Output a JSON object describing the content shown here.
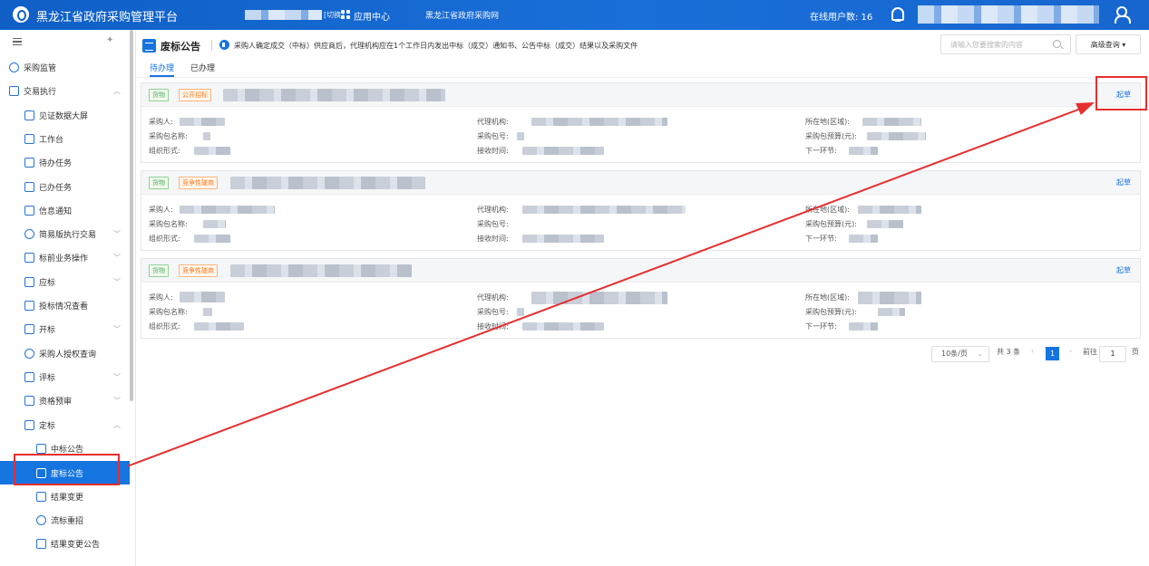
{
  "topbar": {
    "app_title": "黑龙江省政府采购管理平台",
    "switch_label": "[切换]",
    "app_center": "应用中心",
    "site_link": "黑龙江省政府采购网",
    "online_users": "在线用户数: 16"
  },
  "sidebar": {
    "items": [
      {
        "label": "采购监管"
      },
      {
        "label": "交易执行"
      },
      {
        "label": "见证数据大屏"
      },
      {
        "label": "工作台"
      },
      {
        "label": "待办任务"
      },
      {
        "label": "已办任务"
      },
      {
        "label": "信息通知"
      },
      {
        "label": "简易版执行交易"
      },
      {
        "label": "标前业务操作"
      },
      {
        "label": "应标"
      },
      {
        "label": "投标情况查看"
      },
      {
        "label": "开标"
      },
      {
        "label": "采购人授权查询"
      },
      {
        "label": "评标"
      },
      {
        "label": "资格预审"
      },
      {
        "label": "定标"
      },
      {
        "label": "中标公告"
      },
      {
        "label": "废标公告"
      },
      {
        "label": "结果变更"
      },
      {
        "label": "流标重招"
      },
      {
        "label": "结果变更公告"
      }
    ]
  },
  "header": {
    "title": "废标公告",
    "notice": "采购人确定成交（中标）供应商后，代理机构应在1个工作日内发出中标（成交）通知书、公告中标（成交）结果以及采购文件",
    "search_placeholder": "请输入您要搜索的内容",
    "advanced_search": "高级查询"
  },
  "tabs": [
    {
      "label": "待办理"
    },
    {
      "label": "已办理"
    }
  ],
  "field_labels": {
    "purchaser": "采购人:",
    "agency": "代理机构:",
    "region": "所在地(区域):",
    "package_name": "采购包名称:",
    "package_no": "采购包号:",
    "budget": "采购包预算(元):",
    "org_form": "组织形式:",
    "receive_time": "接收时间:",
    "next_step": "下一环节:"
  },
  "cards": [
    {
      "goods_tag": "货物",
      "method_tag": "公开招标",
      "action": "起草"
    },
    {
      "goods_tag": "货物",
      "method_tag": "竞争性磋商",
      "action": "起草"
    },
    {
      "goods_tag": "货物",
      "method_tag": "竞争性磋商",
      "action": "起草"
    }
  ],
  "pagination": {
    "page_size": "10条/页",
    "total": "共 3 条",
    "current_page": "1",
    "goto_label": "前往",
    "goto_value": "1",
    "page_unit": "页"
  },
  "colors": {
    "primary": "#1574df",
    "annotation_red": "#e62e2e",
    "goods_tag": "#4caf50",
    "method_tag": "#ff7a1a"
  }
}
